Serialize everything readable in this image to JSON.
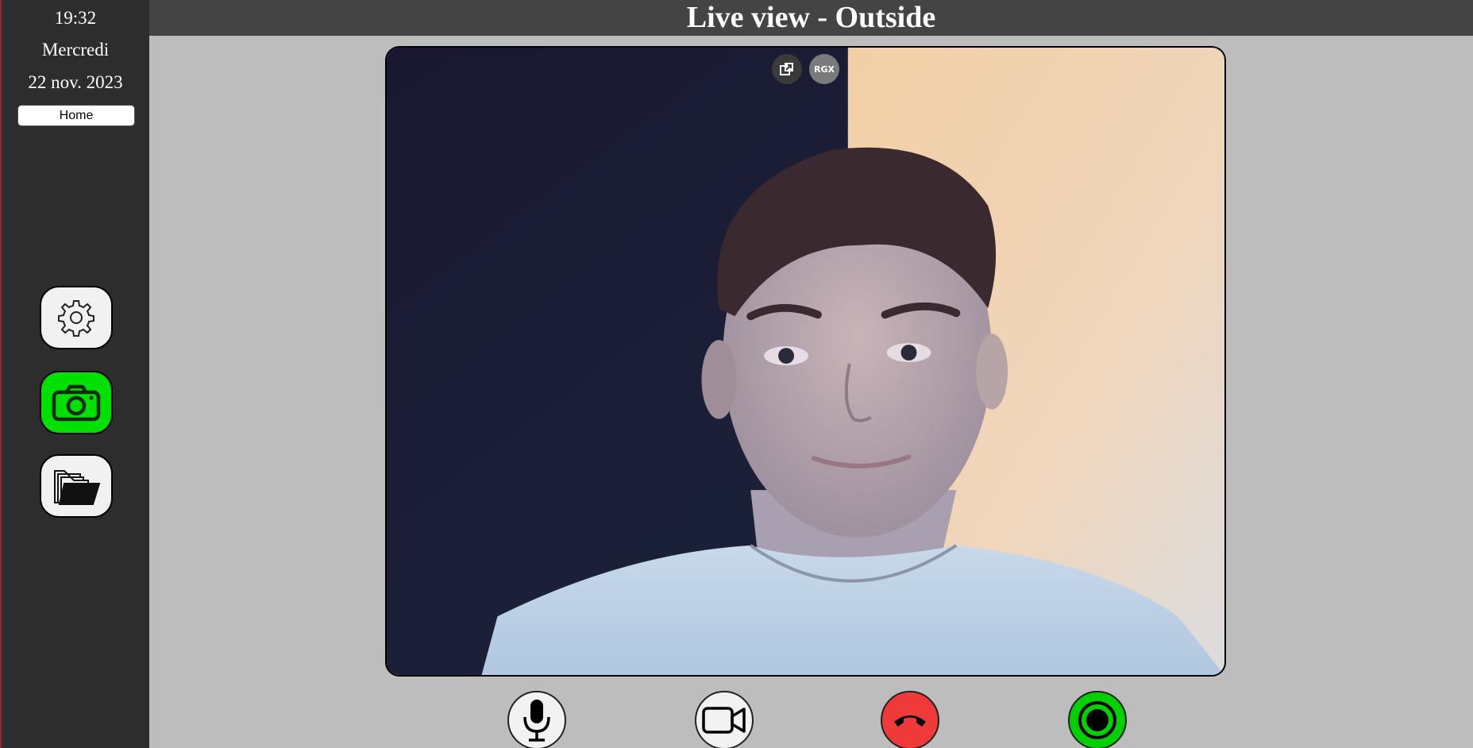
{
  "sidebar": {
    "time": "19:32",
    "day": "Mercredi",
    "date": "22 nov. 2023",
    "home_label": "Home",
    "buttons": [
      {
        "name": "settings",
        "icon": "gear-icon",
        "color": "#f1f1f1"
      },
      {
        "name": "camera",
        "icon": "camera-icon",
        "color": "#00e000",
        "active": true
      },
      {
        "name": "files",
        "icon": "folder-icon",
        "color": "#f1f1f1"
      }
    ]
  },
  "header": {
    "title": "Live view - Outside"
  },
  "video": {
    "overlay": {
      "pip_icon": "picture-in-picture-icon",
      "rgx_label": "RGX"
    }
  },
  "controls": [
    {
      "name": "microphone",
      "icon": "microphone-icon",
      "color": "#f2f2f2"
    },
    {
      "name": "video",
      "icon": "video-camera-icon",
      "color": "#f2f2f2"
    },
    {
      "name": "hang-up",
      "icon": "phone-hangup-icon",
      "color": "#f03a3a"
    },
    {
      "name": "record",
      "icon": "record-icon",
      "color": "#00d000"
    }
  ],
  "colors": {
    "sidebar_bg": "#2d2d2d",
    "header_bg": "#444444",
    "page_bg": "#bdbdbd",
    "active_green": "#00e000",
    "hangup_red": "#f03a3a"
  }
}
